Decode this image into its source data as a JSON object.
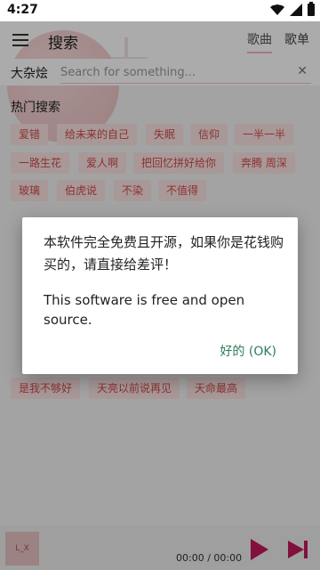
{
  "status_bar": {
    "time": "4:27"
  },
  "app_bar": {
    "title": "搜索",
    "tabs": [
      {
        "label": "歌曲"
      },
      {
        "label": "歌单"
      }
    ]
  },
  "search": {
    "scope": "大杂烩",
    "placeholder": "Search for something...",
    "clear": "✕"
  },
  "hot_search": {
    "title": "热门搜索",
    "chips": [
      "爱错",
      "给未来的自己",
      "失眠",
      "信仰",
      "一半一半",
      "一路生花",
      "爱人啊",
      "把回忆拼好给你",
      "奔腾 周深",
      "玻璃",
      "伯虎说",
      "不染",
      "不值得",
      "是我不够好",
      "天亮以前说再见",
      "天命最高"
    ]
  },
  "player": {
    "cover_text": "L_X",
    "time": "00:00 / 00:00"
  },
  "dialog": {
    "message_cn": "本软件完全免费且开源，如果你是花钱购买的，请直接给差评！",
    "message_en": "This software is free and open source.",
    "ok_label": "好的 (OK)"
  },
  "colors": {
    "accent": "#c2185b",
    "chip_bg": "#fbe3e3",
    "chip_text": "#d44a4a",
    "ok_text": "#2e7d5b"
  }
}
